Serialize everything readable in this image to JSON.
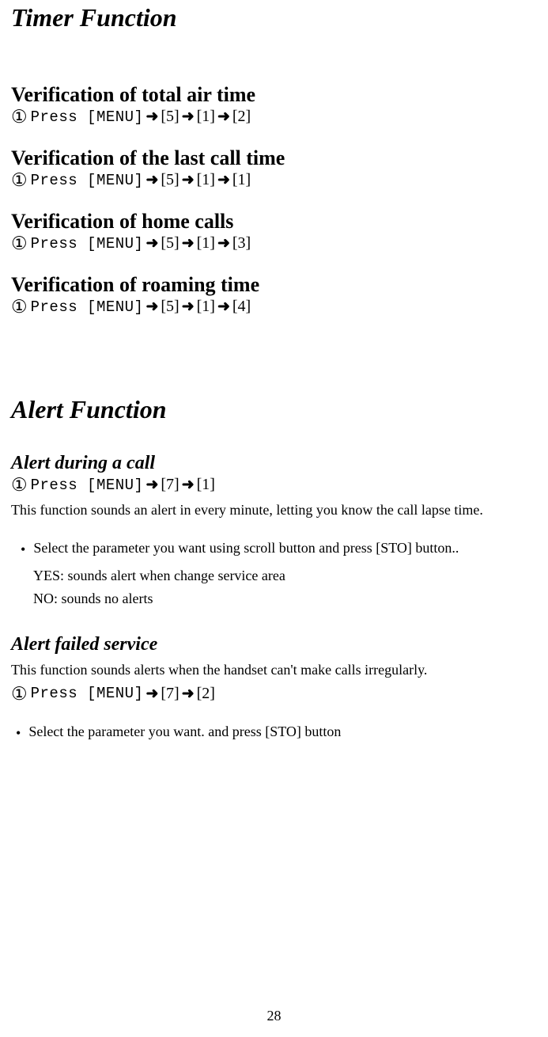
{
  "page": {
    "number": "28"
  },
  "titles": {
    "timer": "Timer Function",
    "alert": "Alert Function"
  },
  "sections": {
    "totalAir": {
      "heading": "Verification of total air time",
      "step": {
        "circled": "①",
        "press": "Press [MENU]",
        "arrow": "➜",
        "k1": "[5]",
        "k2": "[1]",
        "k3": "[2]"
      }
    },
    "lastCall": {
      "heading": "Verification of the last call time",
      "step": {
        "circled": "①",
        "press": "Press [MENU]",
        "arrow": "➜",
        "k1": "[5]",
        "k2": "[1]",
        "k3": "[1]"
      }
    },
    "homeCalls": {
      "heading": "Verification of home calls",
      "step": {
        "circled": "①",
        "press": "Press [MENU]",
        "arrow": "➜",
        "k1": "[5]",
        "k2": "[1]",
        "k3": "[3]"
      }
    },
    "roaming": {
      "heading": "Verification of roaming time",
      "step": {
        "circled": "①",
        "press": "Press [MENU]",
        "arrow": "➜",
        "k1": "[5]",
        "k2": "[1]",
        "k3": "[4]"
      }
    },
    "alertDuring": {
      "heading": "Alert during a call",
      "step": {
        "circled": "①",
        "press": "Press [MENU]",
        "arrow": "➜",
        "k1": "[7]",
        "k2": "[1]"
      },
      "desc": "This function sounds an alert in every minute, letting you know the call lapse time.",
      "bullet": "Select the parameter you want using scroll button and press [STO] button..",
      "optYes": "YES: sounds alert when  change service area",
      "optNo": "NO: sounds no alerts"
    },
    "alertFailed": {
      "heading": "Alert failed service",
      "desc": "This function sounds alerts when the handset can't make calls irregularly.",
      "step": {
        "circled": "①",
        "press": "Press [MENU]",
        "arrow": "➜",
        "k1": "[7]",
        "k2": "[2]"
      },
      "bullet": "Select the parameter you want. and press [STO] button"
    }
  },
  "glyphs": {
    "dot": "•"
  }
}
